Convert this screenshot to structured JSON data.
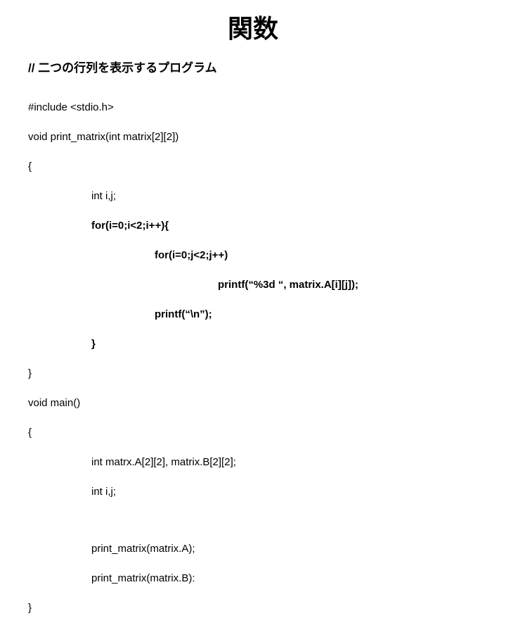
{
  "title": "関数",
  "comment": "// 二つの行列を表示するプログラム",
  "code": {
    "l01": "#include <stdio.h>",
    "l02": "void print_matrix(int matrix[2][2])",
    "l03": "{",
    "l04": "int i,j;",
    "l05": "for(i=0;i<2;i++){",
    "l06": "for(i=0;j<2;j++)",
    "l07": "printf(“%3d “, matrix.A[i][j]);",
    "l08": "printf(“\\n”);",
    "l09": "}",
    "l10": "}",
    "l11": "void main()",
    "l12": "{",
    "l13": "int matrx.A[2][2], matrix.B[2][2];",
    "l14": "int i,j;",
    "l15": "print_matrix(matrix.A);",
    "l16": "print_matrix(matrix.B):",
    "l17": "}"
  }
}
